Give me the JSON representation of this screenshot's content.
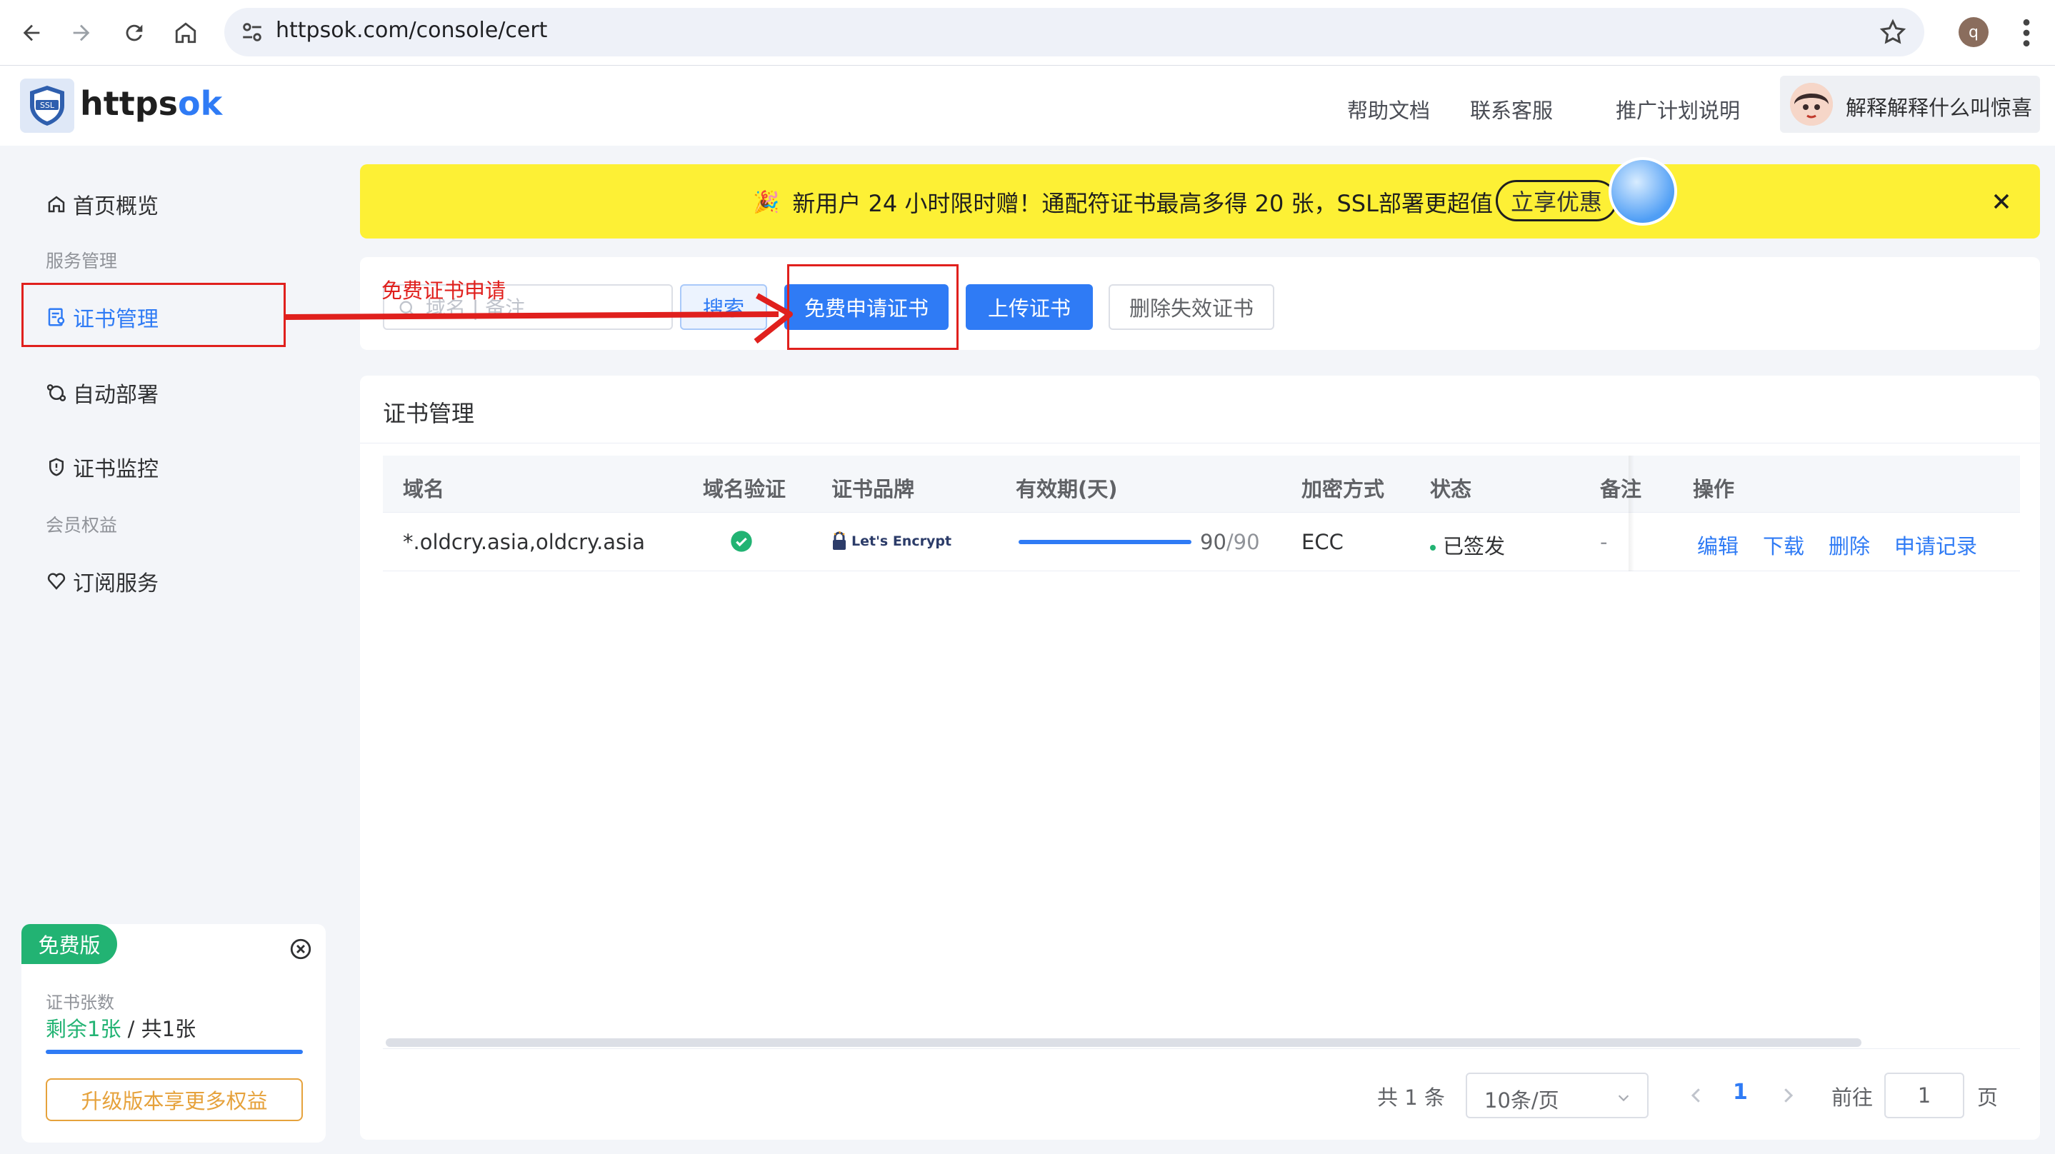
{
  "browser": {
    "url": "httpsok.com/console/cert",
    "profile_initial": "q"
  },
  "header": {
    "brand_main": "https",
    "brand_accent": "ok",
    "logo_text": "SSL",
    "links": [
      "帮助文档",
      "联系客服",
      "推广计划说明"
    ],
    "user_name": "解释解释什么叫惊喜"
  },
  "sidebar": {
    "home": "首页概览",
    "group_service": "服务管理",
    "cert_manage": "证书管理",
    "auto_deploy": "自动部署",
    "cert_monitor": "证书监控",
    "group_member": "会员权益",
    "subscription": "订阅服务",
    "plan": {
      "badge": "免费版",
      "label": "证书张数",
      "remaining": "剩余1张",
      "total": " / 共1张",
      "upgrade": "升级版本享更多权益"
    }
  },
  "promo": {
    "icon": "🎉",
    "text": "新用户 24 小时限时赠！通配符证书最高多得 20 张，SSL部署更超值",
    "cta": "立享优惠"
  },
  "toolbar": {
    "search_placeholder": "域名 | 备注",
    "search_button": "搜索",
    "apply_button": "免费申请证书",
    "upload_button": "上传证书",
    "delete_invalid_button": "删除失效证书"
  },
  "annotation": {
    "label": "免费证书申请"
  },
  "table": {
    "title": "证书管理",
    "columns": [
      "域名",
      "域名验证",
      "证书品牌",
      "有效期(天)",
      "加密方式",
      "状态",
      "备注",
      "操作"
    ],
    "rows": [
      {
        "domain": "*.oldcry.asia,oldcry.asia",
        "brand": "Let's Encrypt",
        "validity_days": 90,
        "validity_total": 90,
        "validity_text": "90",
        "validity_total_text": "/90",
        "encryption": "ECC",
        "status": "已签发",
        "remark": "-",
        "actions": [
          "编辑",
          "下载",
          "删除",
          "申请记录"
        ]
      }
    ]
  },
  "pagination": {
    "total": "共 1 条",
    "page_size": "10条/页",
    "current": "1",
    "goto_label": "前往",
    "goto_value": "1",
    "page_suffix": "页"
  },
  "colors": {
    "primary": "#2f7bf5",
    "success": "#22b373",
    "warning": "#e6a23c",
    "annotation": "#e0201d",
    "promo_bg": "#fdf035"
  }
}
